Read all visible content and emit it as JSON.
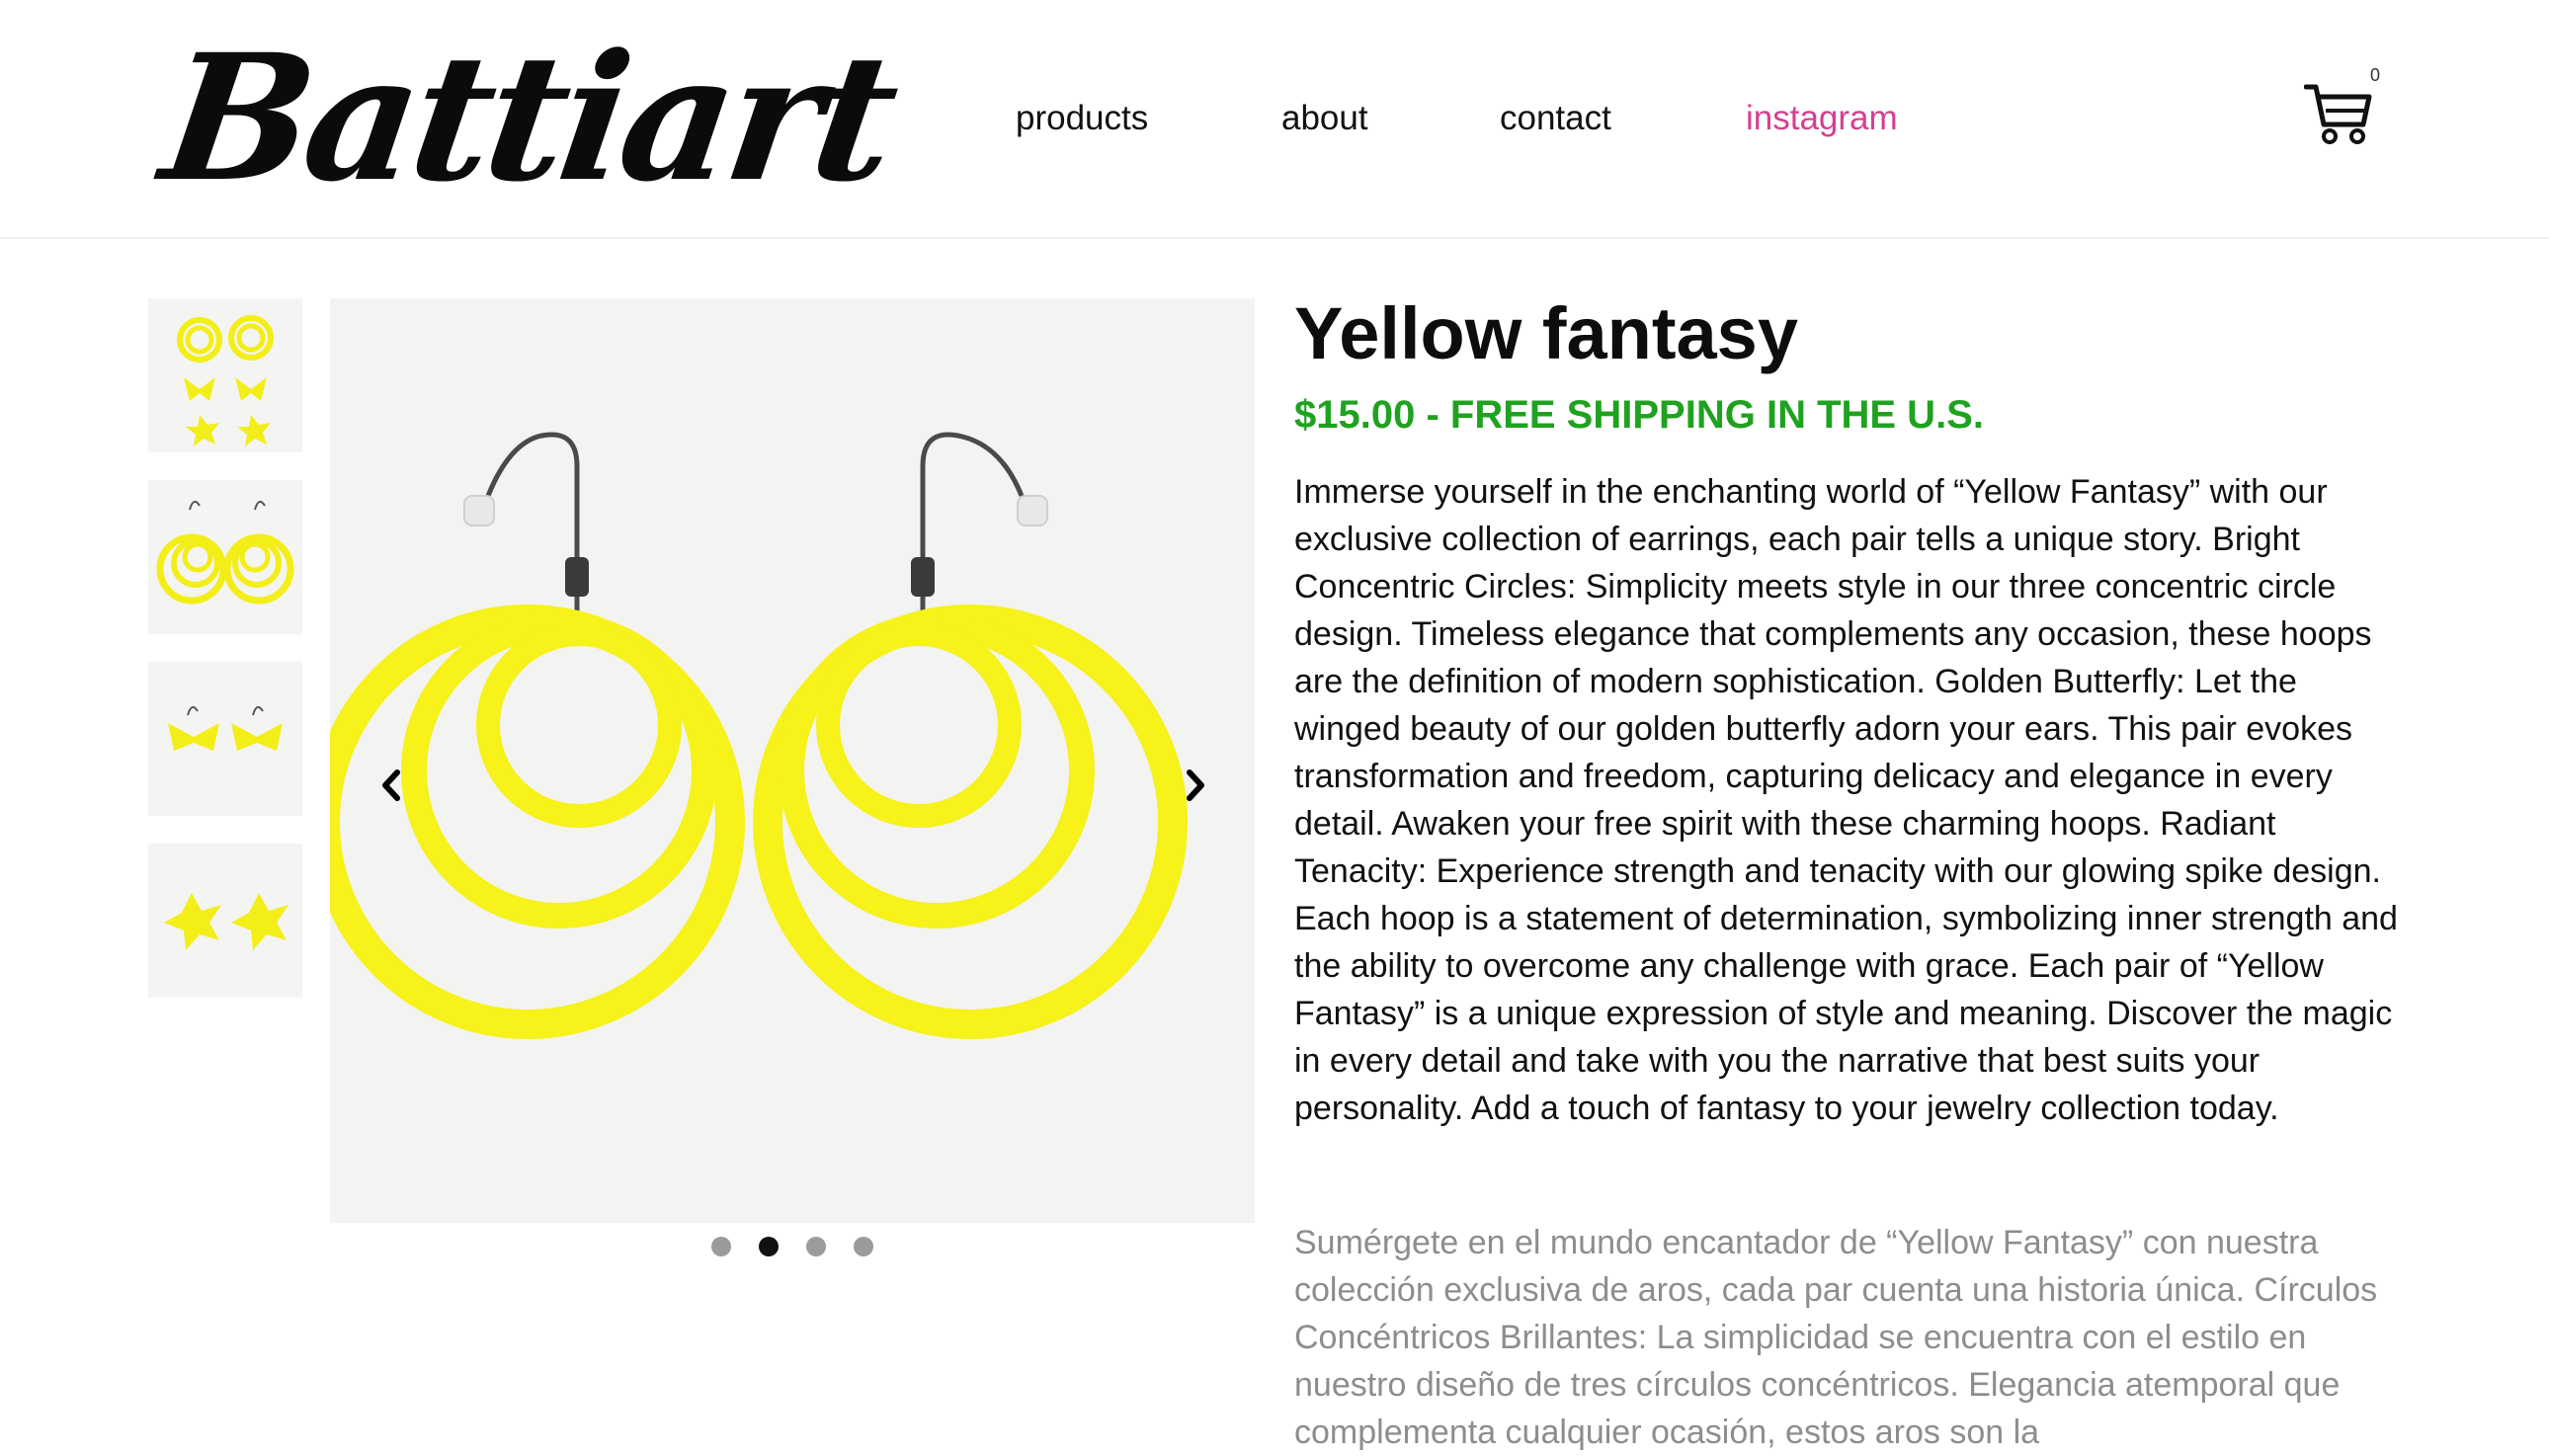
{
  "brand": {
    "logo_text": "Battiart"
  },
  "nav": {
    "items": [
      {
        "label": "products"
      },
      {
        "label": "about"
      },
      {
        "label": "contact"
      },
      {
        "label": "instagram"
      }
    ],
    "accent_color": "#d6408f"
  },
  "cart": {
    "count": "0",
    "icon": "shopping-cart-icon"
  },
  "gallery": {
    "thumbnails": [
      "hoops-and-butterflies",
      "concentric-hoops",
      "butterfly-earrings",
      "star-spike-earrings"
    ],
    "active_index": 1,
    "prev_icon": "chevron-left-icon",
    "next_icon": "chevron-right-icon",
    "image_colors": {
      "earring": "#f6f21a",
      "background": "#f3f3f2"
    }
  },
  "product": {
    "title": "Yellow fantasy",
    "price": "$15.00",
    "shipping": " - FREE SHIPPING IN THE U.S.",
    "price_color": "#1fa21f",
    "description_en": "Immerse yourself in the enchanting world of “Yellow Fantasy” with our exclusive collection of earrings, each pair tells a unique story. Bright Concentric Circles: Simplicity meets style in our three concentric circle design. Timeless elegance that complements any occasion, these hoops are the definition of modern sophistication. Golden Butterfly: Let the winged beauty of our golden butterfly adorn your ears. This pair evokes transformation and freedom, capturing delicacy and elegance in every detail. Awaken your free spirit with these charming hoops. Radiant Tenacity: Experience strength and tenacity with our glowing spike design. Each hoop is a statement of determination, symbolizing inner strength and the ability to overcome any challenge with grace. Each pair of “Yellow Fantasy” is a unique expression of style and meaning. Discover the magic in every detail and take with you the narrative that best suits your personality. Add a touch of fantasy to your jewelry collection today.",
    "description_es": "Sumérgete en el mundo encantador de “Yellow Fantasy” con nuestra colección exclusiva de aros, cada par cuenta una historia única. Círculos Concéntricos Brillantes: La simplicidad se encuentra con el estilo en nuestro diseño de tres círculos concéntricos. Elegancia atemporal que complementa cualquier ocasión, estos aros son la"
  }
}
